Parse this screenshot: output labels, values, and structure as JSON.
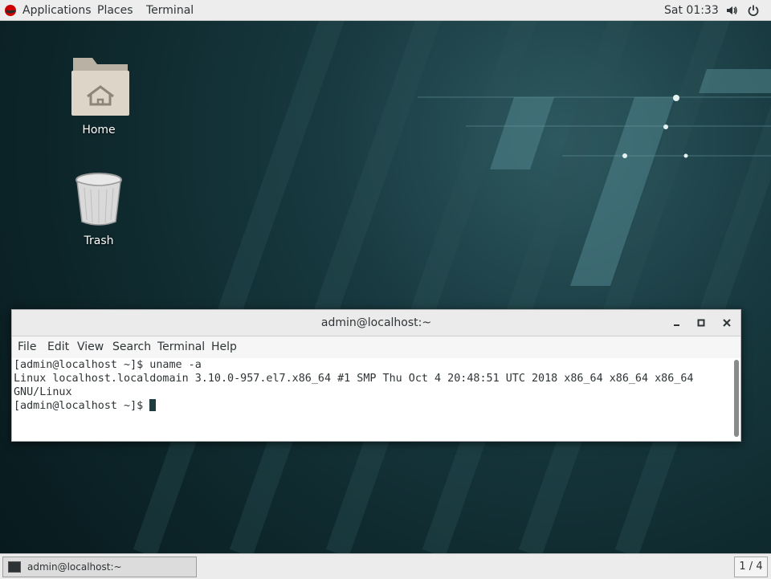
{
  "topbar": {
    "applications_label": "Applications",
    "places_label": "Places",
    "terminal_label": "Terminal",
    "clock": "Sat 01:33"
  },
  "desktop": {
    "icons": [
      {
        "label": "Home",
        "icon": "home-folder-icon"
      },
      {
        "label": "Trash",
        "icon": "trash-icon"
      }
    ]
  },
  "terminal": {
    "title": "admin@localhost:~",
    "menus": [
      "File",
      "Edit",
      "View",
      "Search",
      "Terminal",
      "Help"
    ],
    "lines": [
      "[admin@localhost ~]$ uname -a",
      "Linux localhost.localdomain 3.10.0-957.el7.x86_64 #1 SMP Thu Oct 4 20:48:51 UTC 2018 x86_64 x86_64 x86_64",
      "GNU/Linux",
      "[admin@localhost ~]$ "
    ]
  },
  "taskbar": {
    "window_label": "admin@localhost:~",
    "workspace": "1 / 4"
  },
  "colors": {
    "panel": "#ededed",
    "desktop": "#17393f",
    "cursor": "#1d3c3f"
  }
}
